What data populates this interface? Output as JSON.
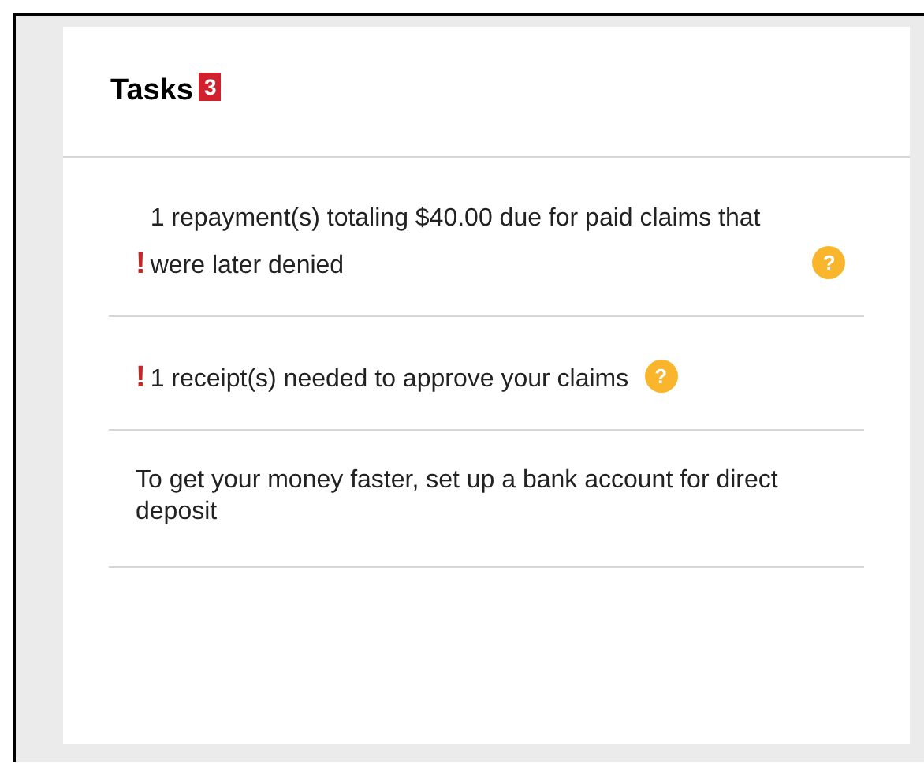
{
  "card": {
    "title": "Tasks",
    "count": "3",
    "items": [
      {
        "alert": "!",
        "text": "1 repayment(s) totaling $40.00 due for paid claims that were later denied",
        "help": "?"
      },
      {
        "alert": "!",
        "text": "1 receipt(s) needed to approve your claims",
        "help": "?"
      },
      {
        "text": "To get your money faster, set up a bank account for direct deposit"
      }
    ]
  }
}
